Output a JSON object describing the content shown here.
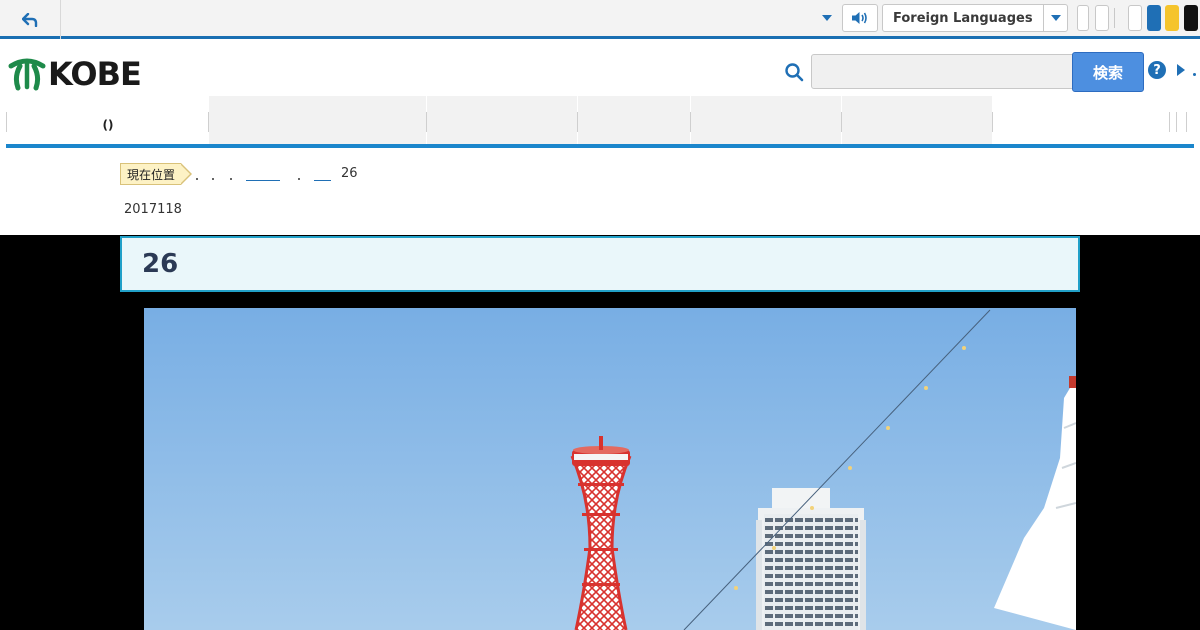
{
  "utility": {
    "language": "Foreign Languages",
    "colors": {
      "accent": "#1a6fb2",
      "blue": "#1f6fb5",
      "yellow": "#f5c42c",
      "black": "#111111"
    }
  },
  "header": {
    "logo_text": "KOBE",
    "search_button": "検索",
    "help": "?"
  },
  "nav": {
    "items": [
      "()",
      "",
      "",
      "",
      "",
      "",
      "",
      ""
    ]
  },
  "breadcrumb": {
    "badge": "現在位置",
    "current": "26"
  },
  "page": {
    "date": "2017118",
    "title": "26"
  }
}
